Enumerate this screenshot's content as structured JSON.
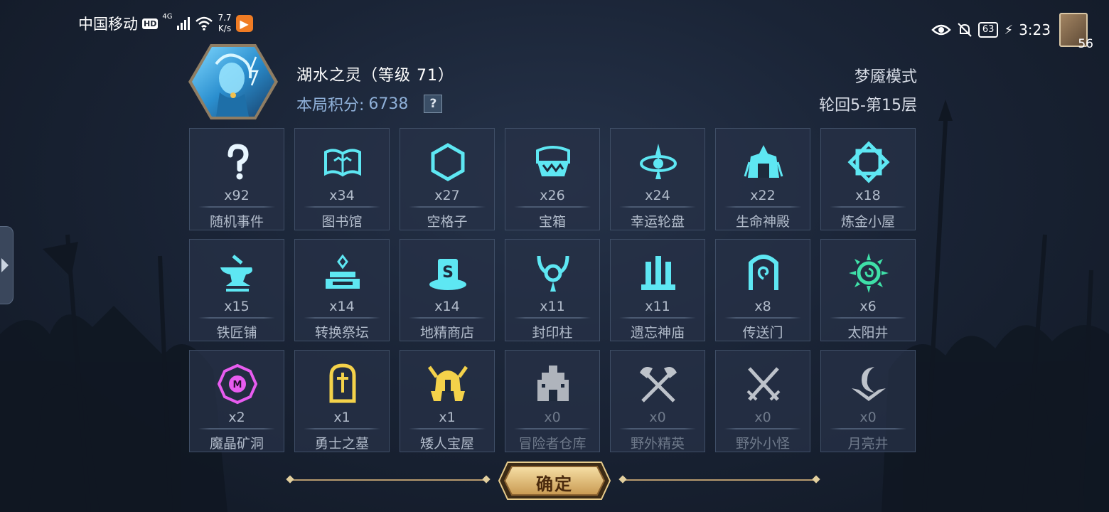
{
  "status_bar": {
    "carrier": "中国移动",
    "hd_badge": "HD",
    "network_type": "4G",
    "net_speed_value": "7.7",
    "net_speed_unit": "K/s",
    "app_icon": "play-icon",
    "battery_level": "63",
    "time": "3:23",
    "notification_count": "56"
  },
  "player": {
    "hero_name": "湖水之灵（等级 71）",
    "score_label": "本局积分:",
    "score_value": "6738",
    "help_symbol": "?"
  },
  "mode": {
    "name": "梦魇模式",
    "level": "轮回5-第15层"
  },
  "items": [
    {
      "label": "随机事件",
      "count": "x92",
      "icon": "question-mark-icon",
      "color": "#e8f6ff"
    },
    {
      "label": "图书馆",
      "count": "x34",
      "icon": "open-book-icon",
      "color": "#5ee7f3"
    },
    {
      "label": "空格子",
      "count": "x27",
      "icon": "hexagon-icon",
      "color": "#5ee7f3"
    },
    {
      "label": "宝箱",
      "count": "x26",
      "icon": "treasure-chest-icon",
      "color": "#5ee7f3"
    },
    {
      "label": "幸运轮盘",
      "count": "x24",
      "icon": "wheel-icon",
      "color": "#5ee7f3"
    },
    {
      "label": "生命神殿",
      "count": "x22",
      "icon": "temple-icon",
      "color": "#5ee7f3"
    },
    {
      "label": "炼金小屋",
      "count": "x18",
      "icon": "alchemy-frame-icon",
      "color": "#5ee7f3"
    },
    {
      "label": "铁匠铺",
      "count": "x15",
      "icon": "anvil-icon",
      "color": "#5ee7f3"
    },
    {
      "label": "转换祭坛",
      "count": "x14",
      "icon": "altar-icon",
      "color": "#5ee7f3"
    },
    {
      "label": "地精商店",
      "count": "x14",
      "icon": "goblin-shop-hat-icon",
      "color": "#5ee7f3"
    },
    {
      "label": "封印柱",
      "count": "x11",
      "icon": "seal-pillar-icon",
      "color": "#5ee7f3"
    },
    {
      "label": "遗忘神庙",
      "count": "x11",
      "icon": "forgotten-temple-icon",
      "color": "#5ee7f3"
    },
    {
      "label": "传送门",
      "count": "x8",
      "icon": "portal-icon",
      "color": "#5ee7f3"
    },
    {
      "label": "太阳井",
      "count": "x6",
      "icon": "sun-well-icon",
      "color": "#3fe0a8"
    },
    {
      "label": "魔晶矿洞",
      "count": "x2",
      "icon": "magic-crystal-icon",
      "color": "#e85cf0"
    },
    {
      "label": "勇士之墓",
      "count": "x1",
      "icon": "tombstone-icon",
      "color": "#f4d24a"
    },
    {
      "label": "矮人宝屋",
      "count": "x1",
      "icon": "dwarf-helmet-icon",
      "color": "#f4d24a"
    },
    {
      "label": "冒险者仓库",
      "count": "x0",
      "icon": "warehouse-icon",
      "color": "#c8ccd2"
    },
    {
      "label": "野外精英",
      "count": "x0",
      "icon": "crossed-axes-icon",
      "color": "#d9dde2"
    },
    {
      "label": "野外小怪",
      "count": "x0",
      "icon": "crossed-swords-icon",
      "color": "#d9dde2"
    },
    {
      "label": "月亮井",
      "count": "x0",
      "icon": "moon-well-icon",
      "color": "#d9dde2"
    }
  ],
  "footer": {
    "confirm_label": "确定"
  },
  "colors": {
    "accent_cyan": "#5ee7f3",
    "gold": "#d8b46a",
    "tile_bg": "#263146"
  }
}
